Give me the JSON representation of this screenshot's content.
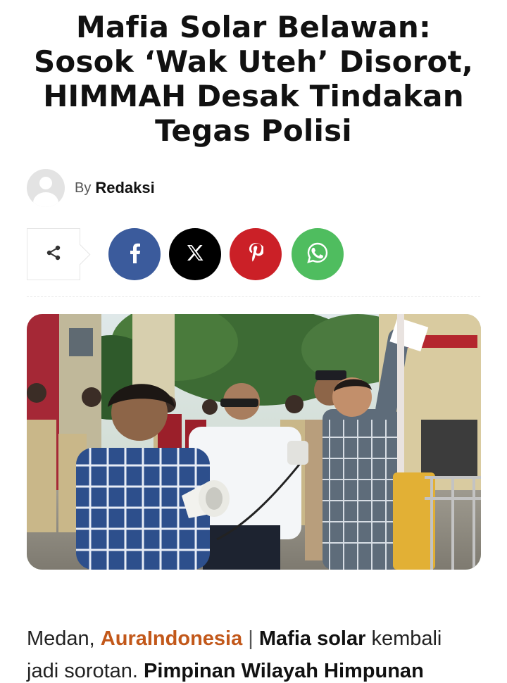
{
  "article": {
    "headline_lines": [
      "Mafia Solar Belawan:",
      "Sosok ‘Wak Uteh’ Disorot,",
      "HIMMAH Desak Tindakan",
      "Tegas Polisi"
    ],
    "byline": {
      "prefix": "By",
      "author": "Redaksi"
    },
    "share": {
      "buttons": [
        {
          "name": "facebook",
          "icon": "facebook-icon",
          "color": "#3b5b9c"
        },
        {
          "name": "x",
          "icon": "x-icon",
          "color": "#000000"
        },
        {
          "name": "pinterest",
          "icon": "pinterest-icon",
          "color": "#cb2027"
        },
        {
          "name": "whatsapp",
          "icon": "whatsapp-icon",
          "color": "#4fbd5f"
        }
      ]
    },
    "body": {
      "city": "Medan, ",
      "brand": "AuraIndonesia",
      "separator": " | ",
      "lead_bold": "Mafia solar",
      "lead_rest": " kembali",
      "line2_normal": "jadi sorotan. ",
      "line2_bold": "Pimpinan Wilayah Himpunan"
    },
    "colors": {
      "brand": "#c2581a",
      "text": "#111111"
    }
  }
}
